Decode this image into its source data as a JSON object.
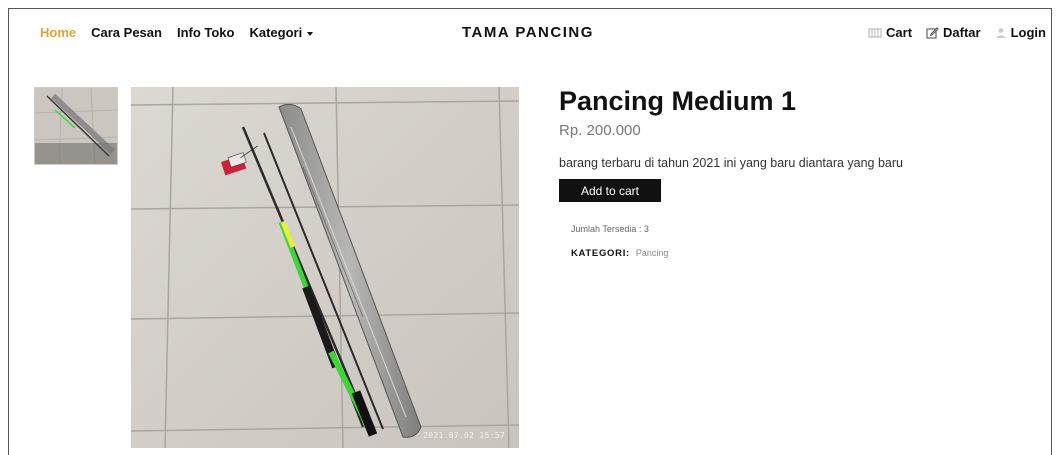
{
  "nav": {
    "home": "Home",
    "cara_pesan": "Cara Pesan",
    "info_toko": "Info Toko",
    "kategori": "Kategori"
  },
  "brand": "TAMA PANCING",
  "nav_right": {
    "cart": "Cart",
    "daftar": "Daftar",
    "login": "Login"
  },
  "product": {
    "title": "Pancing Medium 1",
    "price": "Rp. 200.000",
    "description": "barang terbaru di tahun 2021 ini yang baru diantara yang baru",
    "add_to_cart": "Add to cart",
    "stock_text": "Jumlah Tersedia : 3",
    "category_label": "KATEGORI:",
    "category_value": "Pancing",
    "photo_timestamp": "2021.07.02 15:57"
  },
  "colors": {
    "accent": "#e0a33a",
    "button": "#111111",
    "rod_green": "#3fd43a"
  }
}
